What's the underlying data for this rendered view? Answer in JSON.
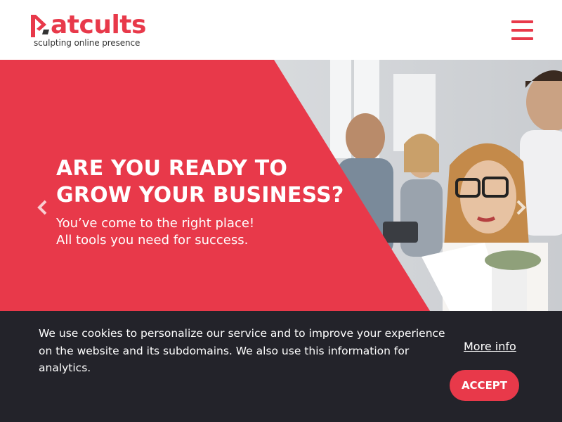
{
  "brand": {
    "name": "atcults",
    "tagline": "sculpting online presence",
    "accent_color": "#e8394a"
  },
  "header": {
    "menu_icon": "hamburger-menu-icon"
  },
  "hero": {
    "title_line1": "ARE YOU READY TO",
    "title_line2": "GROW YOUR BUSINESS?",
    "subtitle_line1": "You’ve come to the right place!",
    "subtitle_line2": "All tools you need for success.",
    "prev_icon": "chevron-left-icon",
    "next_icon": "chevron-right-icon"
  },
  "cookie_bar": {
    "text": "We use cookies to personalize our service and to improve your experience on the website and its subdomains. We also use this information for analytics.",
    "more_info_label": "More info",
    "accept_label": "ACCEPT",
    "background": "#23232a"
  }
}
